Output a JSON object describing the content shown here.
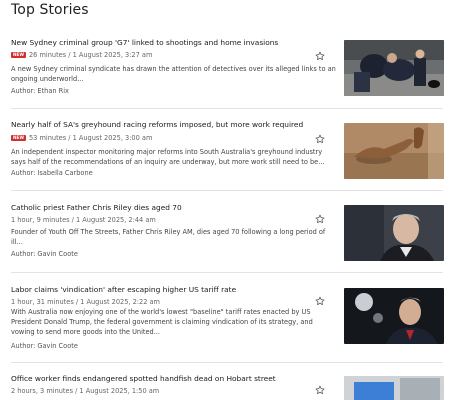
{
  "section": {
    "title": "Top Stories"
  },
  "new_badge_label": "NEW",
  "stories": [
    {
      "headline": "New Sydney criminal group 'G7' linked to shootings and home invasions",
      "is_new": true,
      "meta": "26 minutes / 1 August 2025, 3:27 am",
      "summary": "A new Sydney criminal syndicate has drawn the attention of detectives over its alleged links to an ongoing underworld...",
      "author": "Author: Ethan Rix",
      "image_desc": "police-arrest-photo"
    },
    {
      "headline": "Nearly half of SA's greyhound racing reforms imposed, but more work required",
      "is_new": true,
      "meta": "53 minutes / 1 August 2025, 3:00 am",
      "summary": "An independent inspector monitoring major reforms into South Australia's greyhound industry says half of the recommendations of an inquiry are underway, but more work still need to be...",
      "author": "Author: Isabella Carbone",
      "image_desc": "greyhound-racing-photo"
    },
    {
      "headline": "Catholic priest Father Chris Riley dies aged 70",
      "is_new": false,
      "meta": "1 hour, 9 minutes / 1 August 2025, 2:44 am",
      "summary": "Founder of Youth Off The Streets, Father Chris Riley AM, dies aged 70 following a long period of ill...",
      "author": "Author: Gavin Coote",
      "image_desc": "priest-portrait-photo"
    },
    {
      "headline": "Labor claims 'vindication' after escaping higher US tariff rate",
      "is_new": false,
      "meta": "1 hour, 31 minutes / 1 August 2025, 2:22 am",
      "summary": "With Australia now enjoying one of the world's lowest \"baseline\" tariff rates enacted by US President Donald Trump, the federal government is claiming vindication of its strategy, and vowing to send more goods into the United...",
      "author": "Author: Gavin Coote",
      "image_desc": "politician-photo"
    },
    {
      "headline": "Office worker finds endangered spotted handfish dead on Hobart street",
      "is_new": false,
      "meta": "2 hours, 3 minutes / 1 August 2025, 1:50 am",
      "summary": "",
      "author": "",
      "image_desc": "handfish-photo"
    }
  ]
}
